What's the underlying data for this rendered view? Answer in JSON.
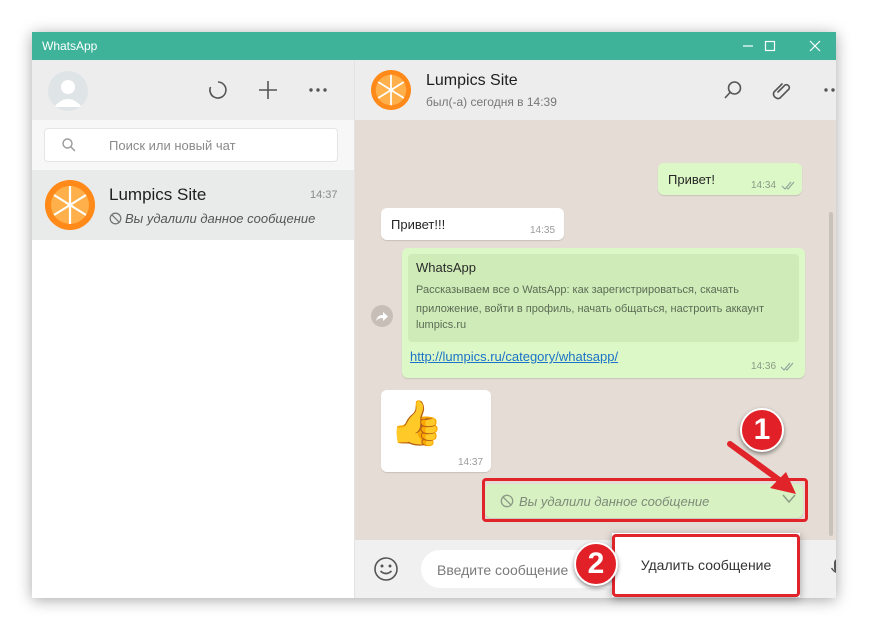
{
  "window": {
    "title": "WhatsApp"
  },
  "sidebar": {
    "search": {
      "placeholder": "Поиск или новый чат"
    },
    "chats": [
      {
        "name": "Lumpics Site",
        "time": "14:37",
        "preview": "Вы удалили данное сообщение"
      }
    ]
  },
  "conversation": {
    "contact_name": "Lumpics Site",
    "contact_status": "был(-а) сегодня в 14:39",
    "messages": [
      {
        "direction": "out",
        "text": "Привет!",
        "time": "14:34",
        "status": "read"
      },
      {
        "direction": "in",
        "text": "Привет!!!",
        "time": "14:35"
      },
      {
        "direction": "out",
        "type": "link",
        "preview_title": "WhatsApp",
        "preview_description": "Рассказываем все о WatsApp: как зарегистрироваться, скачать приложение, войти в профиль, начать общаться, настроить аккаунт",
        "preview_domain": "lumpics.ru",
        "link": "http://lumpics.ru/category/whatsapp/",
        "time": "14:36",
        "status": "read"
      },
      {
        "direction": "in",
        "type": "emoji",
        "emoji": "👍",
        "time": "14:37"
      },
      {
        "direction": "out",
        "type": "deleted",
        "text": "Вы удалили данное сообщение"
      }
    ],
    "composer": {
      "placeholder": "Введите сообщение"
    }
  },
  "context_menu": {
    "items": [
      {
        "label": "Удалить сообщение"
      }
    ]
  },
  "annotations": {
    "step1": "1",
    "step2": "2"
  },
  "colors": {
    "titlebar": "#3eb39a",
    "outgoing_bubble": "#dcf8c6",
    "incoming_bubble": "#ffffff",
    "chat_background": "#e5ddd5",
    "annotation_red": "#e1232a",
    "link": "#1a73c8"
  },
  "icons": {
    "avatar": "default-avatar-icon",
    "status": "status-icon",
    "new_chat": "plus-icon",
    "menu": "more-icon",
    "search": "search-icon",
    "attach": "paperclip-icon",
    "emoji": "smiley-icon",
    "mic": "microphone-icon",
    "forward": "forward-icon",
    "deleted": "blocked-icon"
  }
}
